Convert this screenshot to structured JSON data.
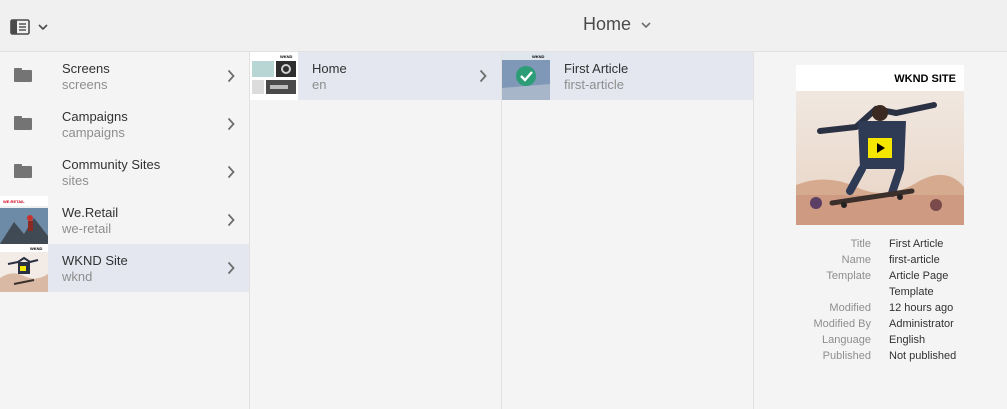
{
  "header": {
    "title": "Home",
    "rail_toggle_icon": "rail-toggle-icon",
    "chevron_icon": "chevron-down-icon"
  },
  "column1": {
    "items": [
      {
        "title": "Screens",
        "name": "screens",
        "type": "folder"
      },
      {
        "title": "Campaigns",
        "name": "campaigns",
        "type": "folder"
      },
      {
        "title": "Community Sites",
        "name": "sites",
        "type": "folder"
      },
      {
        "title": "We.Retail",
        "name": "we-retail",
        "type": "site",
        "thumb_label": "WE.RETAIL"
      },
      {
        "title": "WKND Site",
        "name": "wknd",
        "type": "site",
        "selected": true,
        "thumb_label": "WKND SITE"
      }
    ]
  },
  "column2": {
    "items": [
      {
        "title": "Home",
        "name": "en",
        "selected": true,
        "thumb_label": "WKND SITE"
      }
    ]
  },
  "column3": {
    "items": [
      {
        "title": "First Article",
        "name": "first-article",
        "selected": true,
        "thumb_label": "WKND SITE"
      }
    ]
  },
  "preview": {
    "brand": "WKND SITE",
    "meta": [
      {
        "key": "Title",
        "value": "First Article"
      },
      {
        "key": "Name",
        "value": "first-article"
      },
      {
        "key": "Template",
        "value": "Article Page"
      },
      {
        "key": "",
        "value": "Template"
      },
      {
        "key": "Modified",
        "value": "12 hours ago"
      },
      {
        "key": "Modified By",
        "value": "Administrator"
      },
      {
        "key": "Language",
        "value": "English"
      },
      {
        "key": "Published",
        "value": "Not published"
      }
    ]
  },
  "colors": {
    "selected_bg": "#e4e7ef",
    "play_button": "#f5e600",
    "selection_check": "#2d9d78"
  }
}
